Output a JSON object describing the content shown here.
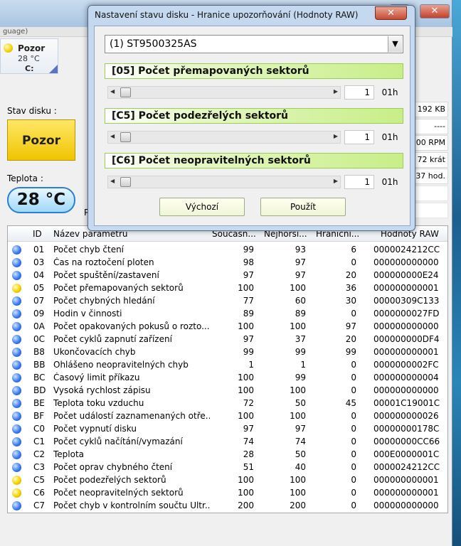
{
  "main": {
    "menu_fragment": "guage)",
    "disk_button": {
      "status": "Pozor",
      "temp": "28 °C",
      "drive": "C:"
    },
    "status_label": "Stav disku :",
    "status_value": "Pozor",
    "temp_label": "Teplota :",
    "temp_value": "28 °C",
    "right_info": [
      "192 KB",
      "----",
      "00 RPM",
      "72 krát",
      "37 hod."
    ],
    "left_fragment_p": "P",
    "window_controls": {
      "minimize": "–",
      "maximize": "□",
      "close": "✕"
    }
  },
  "table": {
    "headers": [
      "ID",
      "Název parametru",
      "Současn...",
      "Nejhorší...",
      "Hraniční...",
      "Hodnoty RAW"
    ],
    "rows": [
      {
        "status": "blue",
        "id": "01",
        "name": "Počet chyb čtení",
        "cur": "99",
        "worst": "93",
        "thr": "6",
        "raw": "0000024212CC"
      },
      {
        "status": "blue",
        "id": "03",
        "name": "Čas na roztočení ploten",
        "cur": "98",
        "worst": "97",
        "thr": "0",
        "raw": "000000000000"
      },
      {
        "status": "blue",
        "id": "04",
        "name": "Počet spuštění/zastavení",
        "cur": "97",
        "worst": "97",
        "thr": "20",
        "raw": "000000000E24"
      },
      {
        "status": "yellow",
        "id": "05",
        "name": "Počet přemapovaných sektorů",
        "cur": "100",
        "worst": "100",
        "thr": "36",
        "raw": "000000000001"
      },
      {
        "status": "blue",
        "id": "07",
        "name": "Počet chybných hledání",
        "cur": "77",
        "worst": "60",
        "thr": "30",
        "raw": "00000309C133"
      },
      {
        "status": "blue",
        "id": "09",
        "name": "Hodin v činnosti",
        "cur": "89",
        "worst": "89",
        "thr": "0",
        "raw": "0000000027FD"
      },
      {
        "status": "blue",
        "id": "0A",
        "name": "Počet opakovaných pokusů o rozto...",
        "cur": "100",
        "worst": "100",
        "thr": "97",
        "raw": "000000000000"
      },
      {
        "status": "blue",
        "id": "0C",
        "name": "Počet cyklů zapnutí zařízení",
        "cur": "97",
        "worst": "37",
        "thr": "20",
        "raw": "000000000DF4"
      },
      {
        "status": "blue",
        "id": "B8",
        "name": "Ukončovacích chyb",
        "cur": "99",
        "worst": "99",
        "thr": "99",
        "raw": "000000000001"
      },
      {
        "status": "blue",
        "id": "BB",
        "name": "Ohlášeno neopravitelných chyb",
        "cur": "1",
        "worst": "1",
        "thr": "0",
        "raw": "0000000002FC"
      },
      {
        "status": "blue",
        "id": "BC",
        "name": "Časový limit příkazu",
        "cur": "100",
        "worst": "99",
        "thr": "0",
        "raw": "000000000004"
      },
      {
        "status": "blue",
        "id": "BD",
        "name": "Vysoká rychlost zápisu",
        "cur": "100",
        "worst": "100",
        "thr": "0",
        "raw": "000000000000"
      },
      {
        "status": "blue",
        "id": "BE",
        "name": "Teplota toku vzduchu",
        "cur": "72",
        "worst": "50",
        "thr": "45",
        "raw": "00001C19001C"
      },
      {
        "status": "blue",
        "id": "BF",
        "name": "Počet událostí zaznamenaných otře...",
        "cur": "100",
        "worst": "100",
        "thr": "0",
        "raw": "000000000026"
      },
      {
        "status": "blue",
        "id": "C0",
        "name": "Počet vypnutí disku",
        "cur": "97",
        "worst": "97",
        "thr": "0",
        "raw": "00000000178C"
      },
      {
        "status": "blue",
        "id": "C1",
        "name": "Počet cyklů načítání/vymazání",
        "cur": "74",
        "worst": "74",
        "thr": "0",
        "raw": "00000000CC66"
      },
      {
        "status": "blue",
        "id": "C2",
        "name": "Teplota",
        "cur": "28",
        "worst": "50",
        "thr": "0",
        "raw": "000E0000001C"
      },
      {
        "status": "blue",
        "id": "C3",
        "name": "Počet oprav chybného čtení",
        "cur": "51",
        "worst": "40",
        "thr": "0",
        "raw": "0000024212CC"
      },
      {
        "status": "yellow",
        "id": "C5",
        "name": "Počet podezřelých sektorů",
        "cur": "100",
        "worst": "100",
        "thr": "0",
        "raw": "000000000001"
      },
      {
        "status": "yellow",
        "id": "C6",
        "name": "Počet neopravitelných sektorů",
        "cur": "100",
        "worst": "100",
        "thr": "0",
        "raw": "000000000001"
      },
      {
        "status": "blue",
        "id": "C7",
        "name": "Počet chyb v kontrolním součtu Ultr...",
        "cur": "200",
        "worst": "200",
        "thr": "0",
        "raw": "000000000000"
      }
    ]
  },
  "dialog": {
    "title": "Nastavení stavu disku - Hranice upozorňování (Hodnoty RAW)",
    "close": "✕",
    "drive": "(1) ST9500325AS",
    "sections": [
      {
        "title": "[05] Počet přemapovaných sektorů",
        "value": "1",
        "hex": "01h"
      },
      {
        "title": "[C5] Počet podezřelých sektorů",
        "value": "1",
        "hex": "01h"
      },
      {
        "title": "[C6] Počet neopravitelných sektorů",
        "value": "1",
        "hex": "01h"
      }
    ],
    "default_button": "Výchozí",
    "apply_button": "Použít"
  }
}
